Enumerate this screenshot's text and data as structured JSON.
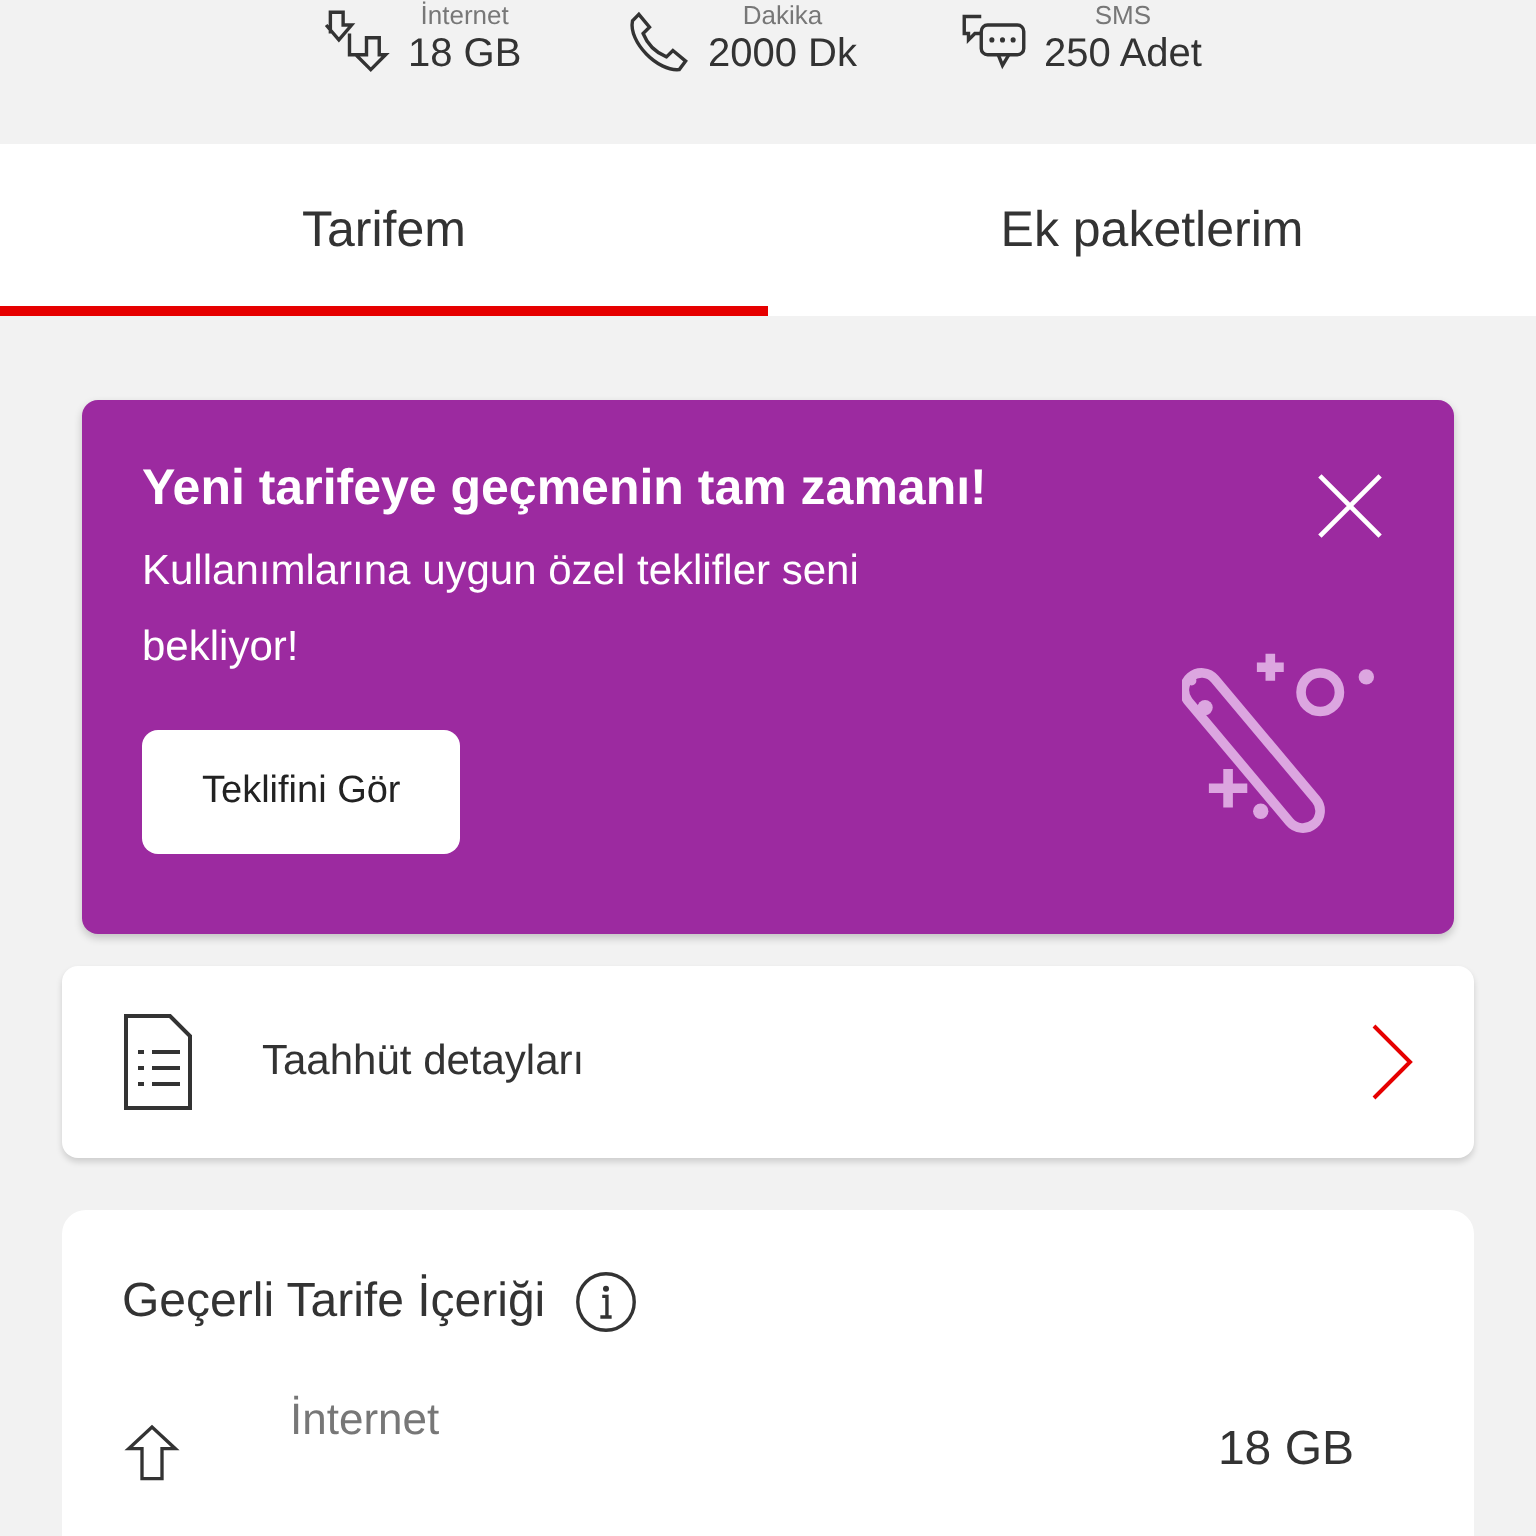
{
  "summary": [
    {
      "kind": "internet",
      "label": "İnternet",
      "value": "18 GB"
    },
    {
      "kind": "call",
      "label": "Dakika",
      "value": "2000 Dk"
    },
    {
      "kind": "sms",
      "label": "SMS",
      "value": "250 Adet"
    }
  ],
  "tabs": [
    {
      "label": "Tarifem",
      "selected": true
    },
    {
      "label": "Ek paketlerim",
      "selected": false
    }
  ],
  "promo": {
    "title": "Yeni tarifeye geçmenin tam zamanı!",
    "text": "Kullanımlarına uygun özel teklifler seni bekliyor!",
    "button": "Teklifini Gör"
  },
  "commitment": {
    "label": "Taahhüt detayları"
  },
  "tariff": {
    "title": "Geçerli Tarife İçeriği",
    "items": [
      {
        "kind": "internet",
        "label": "İnternet",
        "value": "18 GB"
      }
    ]
  }
}
